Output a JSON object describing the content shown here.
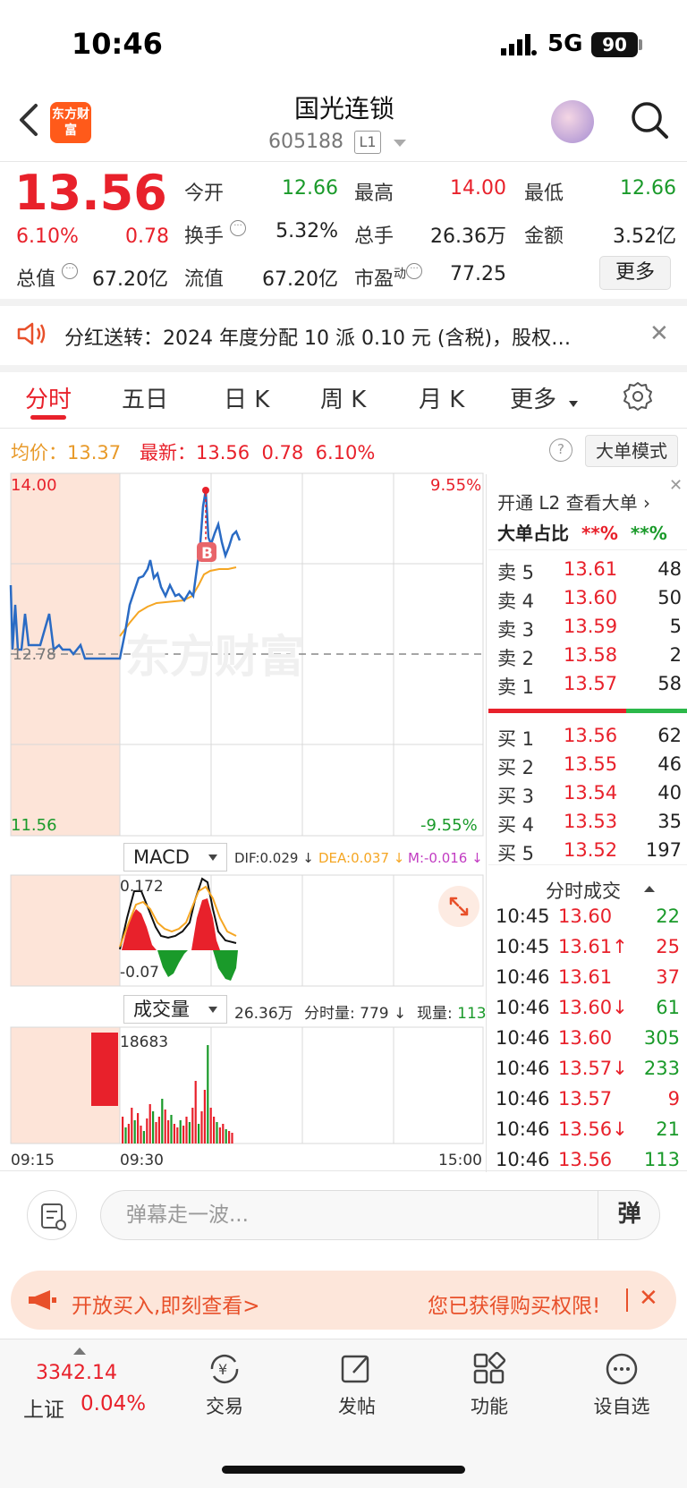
{
  "status": {
    "time": "10:46",
    "network": "5G",
    "battery": "90"
  },
  "header": {
    "app_logo": "东方财富",
    "stock_name": "国光连锁",
    "stock_code": "605188",
    "level_badge": "L1"
  },
  "quote": {
    "price": "13.56",
    "change_pct": "6.10%",
    "change": "0.78",
    "fields": {
      "open_label": "今开",
      "open": "12.66",
      "high_label": "最高",
      "high": "14.00",
      "low_label": "最低",
      "low": "12.66",
      "turnover_label": "换手",
      "turnover": "5.32%",
      "volume_label": "总手",
      "volume": "26.36万",
      "amount_label": "金额",
      "amount": "3.52亿",
      "mcap_label": "总值",
      "mcap": "67.20亿",
      "float_label": "流值",
      "float": "67.20亿",
      "pe_label": "市盈",
      "pe_sup": "动",
      "pe": "77.25"
    },
    "more_label": "更多"
  },
  "notice": {
    "text": "分红送转：2024 年度分配 10 派 0.10 元 (含税)，股权…"
  },
  "tabs": [
    {
      "label": "分时"
    },
    {
      "label": "五日"
    },
    {
      "label": "日 K"
    },
    {
      "label": "周 K"
    },
    {
      "label": "月 K"
    },
    {
      "label": "更多"
    }
  ],
  "info": {
    "avg_label": "均价：",
    "avg": "13.37",
    "latest_label": "最新：",
    "latest": "13.56",
    "latest_chg": "0.78",
    "latest_pct": "6.10%",
    "help": "?",
    "big_mode": "大单模式"
  },
  "chart": {
    "y_top": "14.00",
    "y_bottom": "11.56",
    "pct_top": "9.55%",
    "pct_bottom": "-9.55%",
    "mid_label": "12.78",
    "watermark": "东方财富",
    "marker": "B",
    "macd_label": "MACD",
    "dif": "DIF:0.029 ↓",
    "dea": "DEA:0.037 ↓",
    "m": "M:-0.016 ↓",
    "macd_top": "0.172",
    "macd_bottom": "-0.07",
    "vol_label": "成交量",
    "vol_total": "26.36万",
    "vol_min_label": "分时量:",
    "vol_min": "779 ↓",
    "vol_now_label": "现量:",
    "vol_now": "113",
    "vol_max": "18683",
    "t_start": "09:15",
    "t_open": "09:30",
    "t_end": "15:00"
  },
  "orderbook": {
    "open_l2": "开通 L2 查看大单 ›",
    "ratio_label": "大单占比",
    "ratio_red": "**%",
    "ratio_green": "**%",
    "asks": [
      {
        "label": "卖 5",
        "price": "13.61",
        "vol": "48"
      },
      {
        "label": "卖 4",
        "price": "13.60",
        "vol": "50"
      },
      {
        "label": "卖 3",
        "price": "13.59",
        "vol": "5"
      },
      {
        "label": "卖 2",
        "price": "13.58",
        "vol": "2"
      },
      {
        "label": "卖 1",
        "price": "13.57",
        "vol": "58"
      }
    ],
    "bids": [
      {
        "label": "买 1",
        "price": "13.56",
        "vol": "62"
      },
      {
        "label": "买 2",
        "price": "13.55",
        "vol": "46"
      },
      {
        "label": "买 3",
        "price": "13.54",
        "vol": "40"
      },
      {
        "label": "买 4",
        "price": "13.53",
        "vol": "35"
      },
      {
        "label": "买 5",
        "price": "13.52",
        "vol": "197"
      }
    ],
    "ticks_title": "分时成交",
    "ticks": [
      {
        "time": "10:45",
        "price": "13.60",
        "vol": "22",
        "vc": "green"
      },
      {
        "time": "10:45",
        "price": "13.61↑",
        "vol": "25",
        "vc": "red"
      },
      {
        "time": "10:46",
        "price": "13.61",
        "vol": "37",
        "vc": "red"
      },
      {
        "time": "10:46",
        "price": "13.60↓",
        "vol": "61",
        "vc": "green"
      },
      {
        "time": "10:46",
        "price": "13.60",
        "vol": "305",
        "vc": "green"
      },
      {
        "time": "10:46",
        "price": "13.57↓",
        "vol": "233",
        "vc": "green"
      },
      {
        "time": "10:46",
        "price": "13.57",
        "vol": "9",
        "vc": "red"
      },
      {
        "time": "10:46",
        "price": "13.56↓",
        "vol": "21",
        "vc": "green"
      },
      {
        "time": "10:46",
        "price": "13.56",
        "vol": "113",
        "vc": "green"
      }
    ]
  },
  "comment": {
    "placeholder": "弹幕走一波...",
    "send": "弹"
  },
  "promo": {
    "left": "开放买入,即刻查看>",
    "right": "您已获得购买权限!"
  },
  "bottom": {
    "index_value": "3342.14",
    "index_name": "上证",
    "index_pct": "0.04%",
    "nav": [
      {
        "label": "交易"
      },
      {
        "label": "发帖"
      },
      {
        "label": "功能"
      },
      {
        "label": "设自选"
      }
    ]
  },
  "colors": {
    "up": "#e8212b",
    "down": "#1a9a2a",
    "accent": "#e8212b",
    "price_line": "#2a6bc4",
    "avg_line": "#f5a623"
  }
}
